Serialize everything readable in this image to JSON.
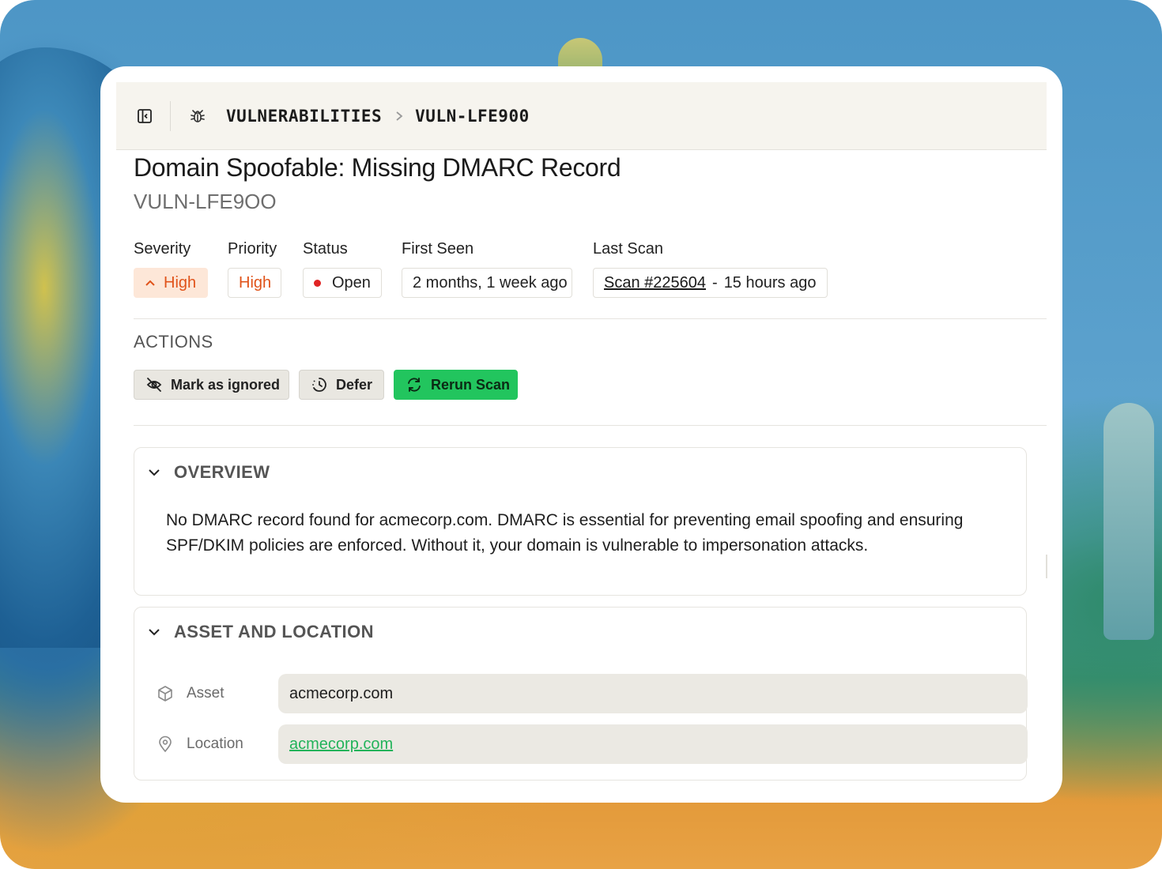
{
  "breadcrumb": {
    "section": "VULNERABILITIES",
    "current": "VULN-LFE900"
  },
  "vuln": {
    "title": "Domain Spoofable: Missing DMARC Record",
    "id": "VULN-LFE9OO"
  },
  "meta": {
    "severity": {
      "label": "Severity",
      "value": "High"
    },
    "priority": {
      "label": "Priority",
      "value": "High"
    },
    "status": {
      "label": "Status",
      "value": "Open"
    },
    "first_seen": {
      "label": "First Seen",
      "value": "2 months, 1 week ago"
    },
    "last_scan": {
      "label": "Last Scan",
      "scan_link": "Scan #225604",
      "separator": "-",
      "ago": "15 hours ago"
    }
  },
  "actions": {
    "heading": "ACTIONS",
    "ignore_label": "Mark as ignored",
    "defer_label": "Defer",
    "rerun_label": "Rerun Scan"
  },
  "overview": {
    "heading": "OVERVIEW",
    "text": "No DMARC record found for acmecorp.com. DMARC is essential for preventing email spoofing and ensuring SPF/DKIM policies are enforced. Without it, your domain is vulnerable to impersonation attacks."
  },
  "asset_location": {
    "heading": "ASSET AND LOCATION",
    "asset_label": "Asset",
    "asset_value": "acmecorp.com",
    "location_label": "Location",
    "location_value": "acmecorp.com"
  },
  "colors": {
    "accent": "#22c55e",
    "severity_text": "#e0531a",
    "severity_bg": "#fde7d8",
    "status_dot": "#e02424"
  }
}
